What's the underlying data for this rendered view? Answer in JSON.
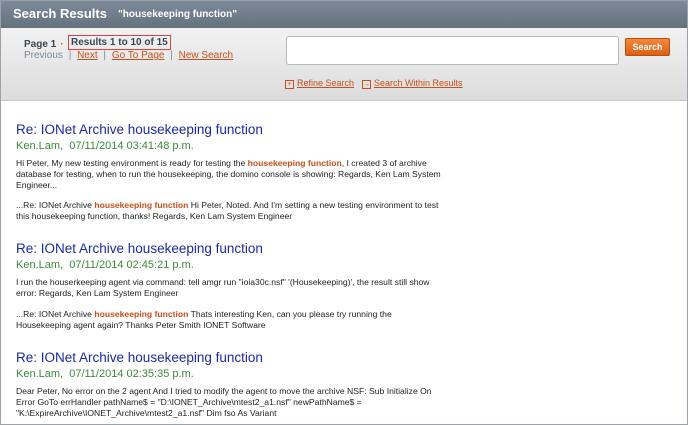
{
  "header": {
    "title": "Search Results",
    "query": "\"housekeeping function\""
  },
  "pager": {
    "page_label": "Page 1",
    "results_label": "Results 1 to 10 of 15",
    "previous": "Previous",
    "next": "Next",
    "goto_page": "Go To Page",
    "new_search": "New Search"
  },
  "search": {
    "input_value": "",
    "button_label": "Search",
    "refine_label": "Refine Search",
    "within_label": "Search Within Results"
  },
  "results": [
    {
      "title": "Re: IONet Archive housekeeping function",
      "author": "Ken.Lam",
      "date": "07/11/2014 03:41:48 p.m.",
      "snippet1": [
        {
          "t": "Hi Peter, My new testing environment is ready for testing the "
        },
        {
          "t": "housekeeping function",
          "h": true
        },
        {
          "t": ", I created 3 of archive database for testing, when to run the housekeeping, the domino console is showing: Regards, Ken Lam System Engineer..."
        }
      ],
      "snippet2": [
        {
          "t": "...Re: IONet Archive "
        },
        {
          "t": "housekeeping function",
          "h": true
        },
        {
          "t": " Hi Peter, Noted. And I'm setting a new testing environment to test this housekeeping function, thanks! Regards, Ken Lam System Engineer"
        }
      ]
    },
    {
      "title": "Re: IONet Archive housekeeping function",
      "author": "Ken.Lam",
      "date": "07/11/2014 02:45:21 p.m.",
      "snippet1": [
        {
          "t": "I run the houserkeeping agent via command: tell amgr run \"ioia30c.nsf\" '(Housekeeping)', the result still show error: Regards, Ken Lam System Engineer"
        }
      ],
      "snippet2": [
        {
          "t": "...Re: IONet Archive "
        },
        {
          "t": "housekeeping function",
          "h": true
        },
        {
          "t": " Thats interesting Ken, can you please try running the Housekeeping agent again? Thanks Peter Smith IONET Software"
        }
      ]
    },
    {
      "title": "Re: IONet Archive housekeeping function",
      "author": "Ken.Lam",
      "date": "07/11/2014 02:35:35 p.m.",
      "snippet1": [
        {
          "t": "Dear Peter, No error on the 2 agent And I tried to modify the agent to move the archive NSF: Sub Initialize On Error GoTo errHandler pathName$ = \"D:\\IONET_Archive\\mtest2_a1.nsf\" newPathName$ = \"K:\\ExpireArchive\\IONET_Archive\\mtest2_a1.nsf\" Dim fso As Variant"
        }
      ],
      "snippet2": []
    }
  ],
  "colors": {
    "title_blue": "#1b2aa5",
    "meta_green": "#3a8a3a",
    "highlight_orange": "#c8501a",
    "header_gray": "#6e7b8a"
  }
}
